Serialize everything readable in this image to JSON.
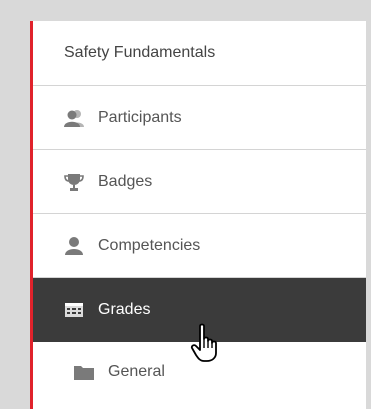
{
  "nav": {
    "course_title": "Safety Fundamentals",
    "items": [
      {
        "label": "Participants",
        "icon": "participants-icon"
      },
      {
        "label": "Badges",
        "icon": "trophy-icon"
      },
      {
        "label": "Competencies",
        "icon": "user-icon"
      },
      {
        "label": "Grades",
        "icon": "table-icon",
        "active": true
      },
      {
        "label": "General",
        "icon": "folder-icon"
      }
    ]
  },
  "colors": {
    "accent": "#e0222b",
    "active_bg": "#3b3b3b",
    "text": "#555555",
    "icon": "#7a7a7a"
  }
}
